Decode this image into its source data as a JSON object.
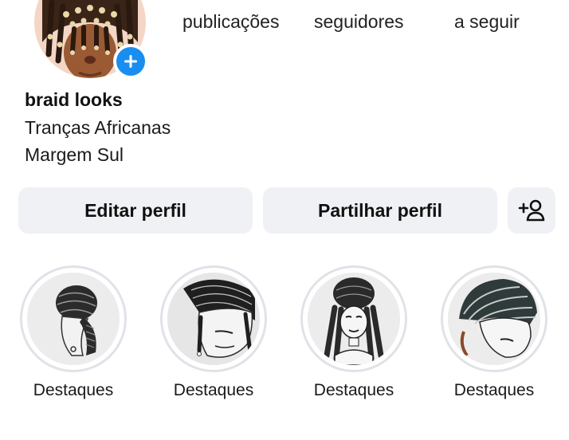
{
  "profile": {
    "username": "braid looks",
    "bio_lines": [
      "Tranças Africanas",
      "Margem Sul"
    ]
  },
  "stats": {
    "posts_label": "publicações",
    "followers_label": "seguidores",
    "following_label": "a seguir"
  },
  "actions": {
    "edit_profile": "Editar perfil",
    "share_profile": "Partilhar perfil",
    "add_person_icon": "person-add-icon"
  },
  "highlights": [
    {
      "label": "Destaques",
      "icon": "braided-bun-illustration"
    },
    {
      "label": "Destaques",
      "icon": "cornrows-illustration"
    },
    {
      "label": "Destaques",
      "icon": "headwrap-braids-illustration"
    },
    {
      "label": "Destaques",
      "icon": "straight-back-braids-illustration"
    }
  ],
  "colors": {
    "accent": "#1a8ef0",
    "button_bg": "#eff1f4",
    "highlight_ring": "#dfe3e8"
  }
}
